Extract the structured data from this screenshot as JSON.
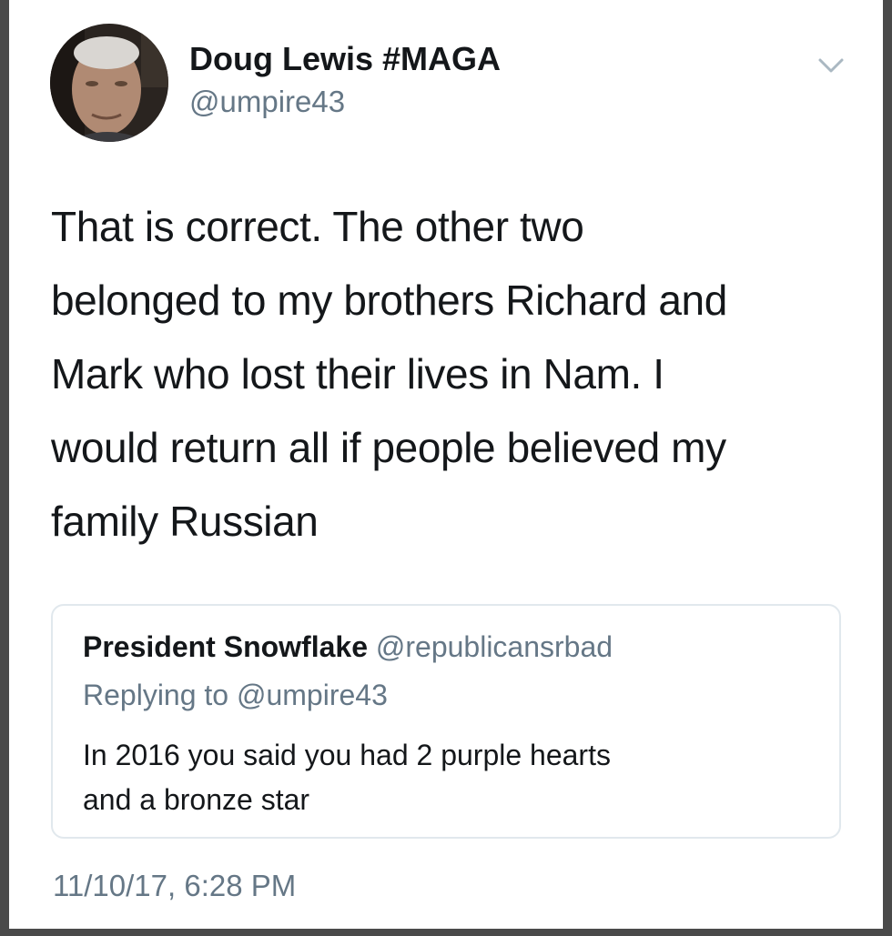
{
  "tweet": {
    "author": {
      "display_name": "Doug Lewis #MAGA",
      "handle": "@umpire43",
      "avatar_icon": "user-avatar-photo"
    },
    "menu_icon": "chevron-down-icon",
    "text": "That is correct. The other two\nbelonged to my brothers Richard and\nMark who lost their lives in Nam. I\nwould return all if people believed my\nfamily Russian",
    "quoted_tweet": {
      "display_name": "President Snowflake",
      "handle": "@republicansrbad",
      "replying_to": "Replying to @umpire43",
      "text": "In 2016 you said you had 2 purple hearts\nand a bronze star"
    },
    "timestamp": "11/10/17, 6:28 PM"
  },
  "colors": {
    "text_primary": "#14171a",
    "text_secondary": "#657786",
    "border": "#e1e8ed",
    "frame": "#4a4a4a",
    "background": "#ffffff"
  }
}
